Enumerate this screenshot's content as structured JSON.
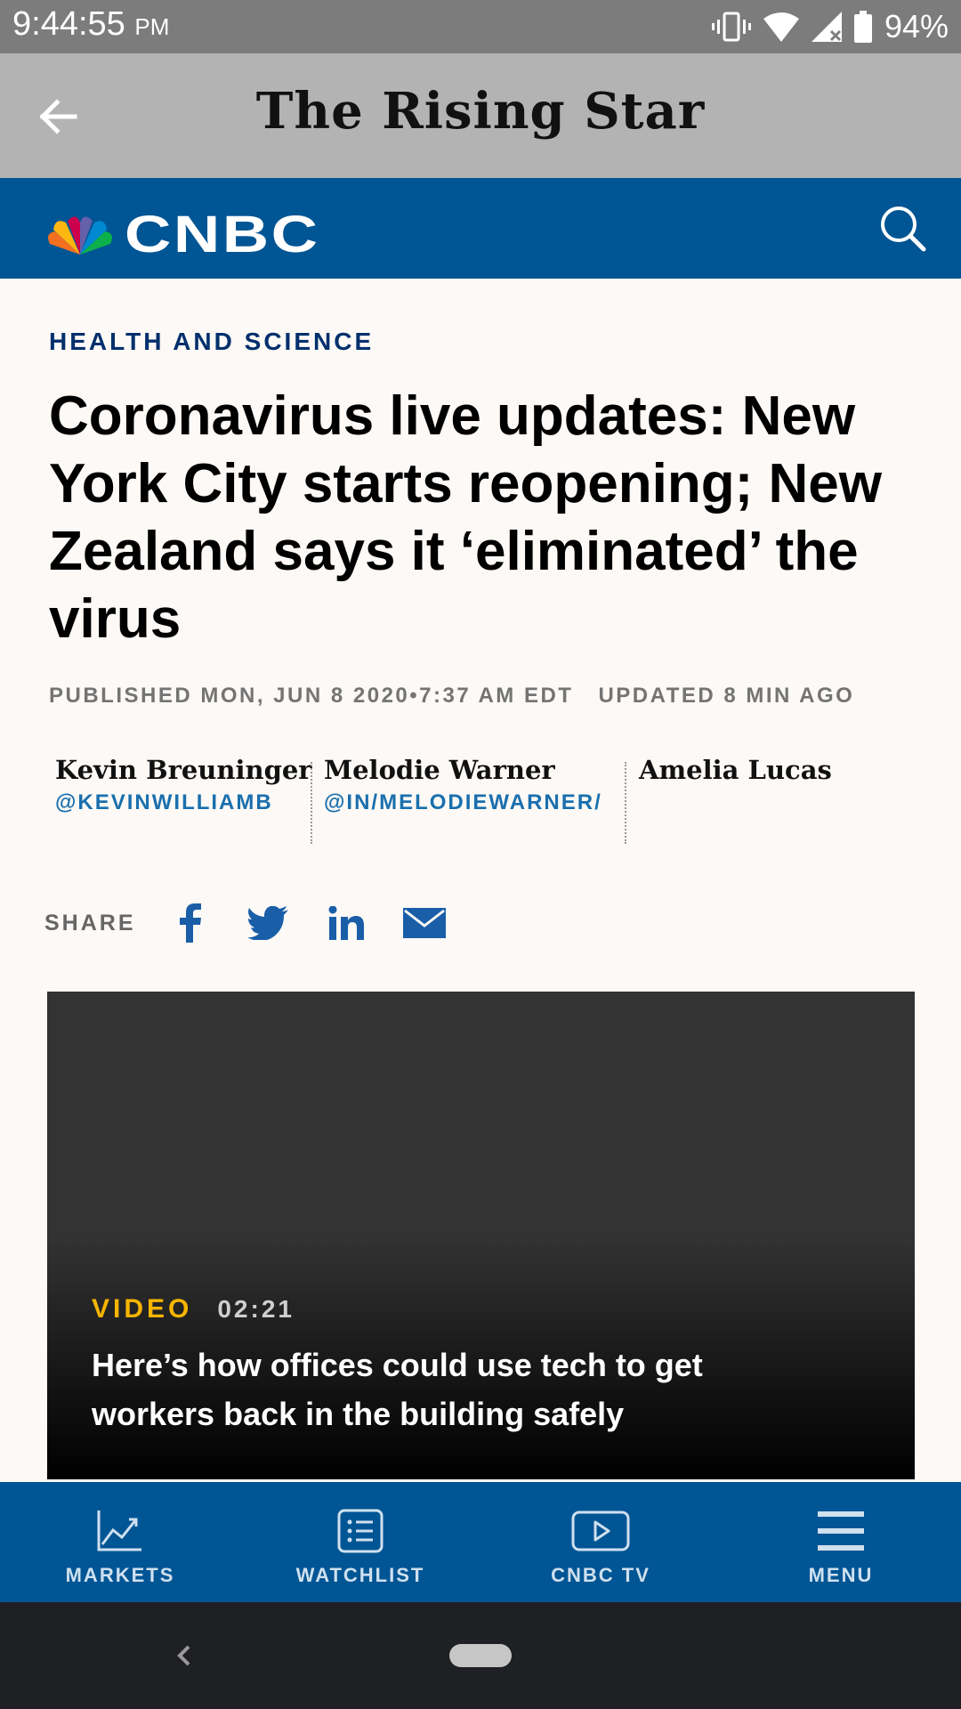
{
  "status_bar": {
    "time": "9:44:55",
    "ampm": "PM",
    "battery": "94%"
  },
  "app_bar": {
    "title": "The Rising Star"
  },
  "cnbc_header": {
    "logo_text": "CNBC"
  },
  "article": {
    "section": "HEALTH AND SCIENCE",
    "headline": "Coronavirus live updates: New York City starts reopening; New Zealand says it ‘eliminated’ the virus",
    "published": "PUBLISHED MON, JUN 8 2020•7:37 AM EDT",
    "updated": "UPDATED 8 MIN AGO",
    "authors": [
      {
        "name": "Kevin Breuninger",
        "handle": "@KEVINWILLIAMB"
      },
      {
        "name": "Melodie Warner",
        "handle": "@IN/MELODIEWARNER/"
      },
      {
        "name": "Amelia Lucas",
        "handle": ""
      }
    ],
    "share_label": "SHARE",
    "share_icons": [
      "facebook-icon",
      "twitter-icon",
      "linkedin-icon",
      "email-icon"
    ]
  },
  "video": {
    "label": "VIDEO",
    "duration": "02:21",
    "title": "Here’s how offices could use tech to get workers back in the building safely"
  },
  "bottom_nav": [
    {
      "label": "MARKETS",
      "icon": "chart-line-icon"
    },
    {
      "label": "WATCHLIST",
      "icon": "list-icon"
    },
    {
      "label": "CNBC TV",
      "icon": "play-icon"
    },
    {
      "label": "MENU",
      "icon": "hamburger-icon"
    }
  ],
  "colors": {
    "cnbc_blue": "#005594",
    "section_navy": "#002f6c",
    "video_accent": "#f7b500",
    "link_blue": "#1a6fad"
  }
}
